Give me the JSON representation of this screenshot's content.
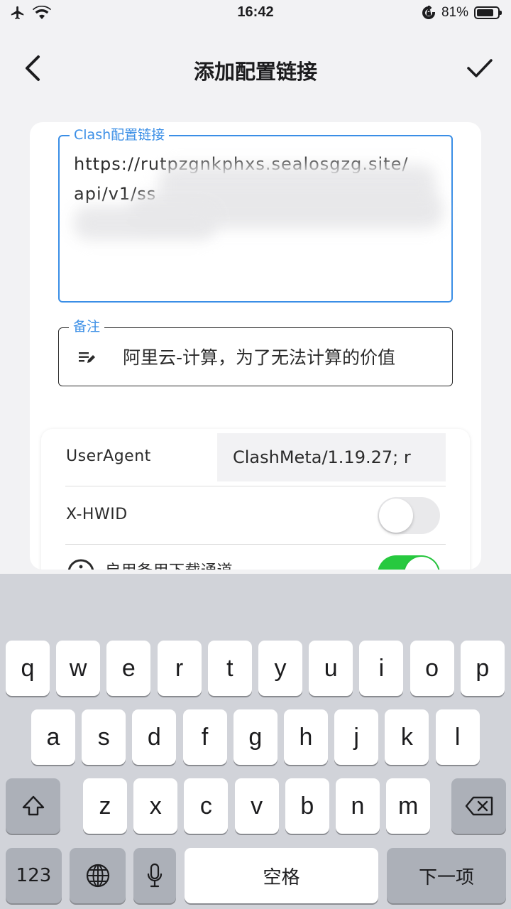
{
  "status_bar": {
    "time": "16:42",
    "battery_percent": "81%",
    "battery_level": 0.81,
    "icons": [
      "airplane-icon",
      "wifi-icon",
      "rotation-lock-icon",
      "battery-icon"
    ]
  },
  "nav": {
    "title": "添加配置链接",
    "back_icon": "chevron-left-icon",
    "confirm_icon": "checkmark-icon"
  },
  "form": {
    "url_field": {
      "label": "Clash配置链接",
      "line1": "https://rutpzgnkphxs.sealosgzg.site/",
      "line2": "api/v1/ss"
    },
    "note_field": {
      "label": "备注",
      "value": "阿里云-计算，为了无法计算的价值",
      "icon": "edit-note-icon"
    }
  },
  "options": {
    "user_agent": {
      "label": "UserAgent",
      "value": "ClashMeta/1.19.27; r"
    },
    "hwid": {
      "label": "X-HWID",
      "enabled": false
    },
    "backup_channel": {
      "label": "启用备用下载通道",
      "enabled": true,
      "icon": "info-icon"
    }
  },
  "keyboard": {
    "row1": [
      "q",
      "w",
      "e",
      "r",
      "t",
      "y",
      "u",
      "i",
      "o",
      "p"
    ],
    "row2": [
      "a",
      "s",
      "d",
      "f",
      "g",
      "h",
      "j",
      "k",
      "l"
    ],
    "row3": [
      "z",
      "x",
      "c",
      "v",
      "b",
      "n",
      "m"
    ],
    "numbers_key": "123",
    "space_key": "空格",
    "next_key": "下一项",
    "accent": "#3a8ee6",
    "toggle_on_color": "#27c93f"
  }
}
